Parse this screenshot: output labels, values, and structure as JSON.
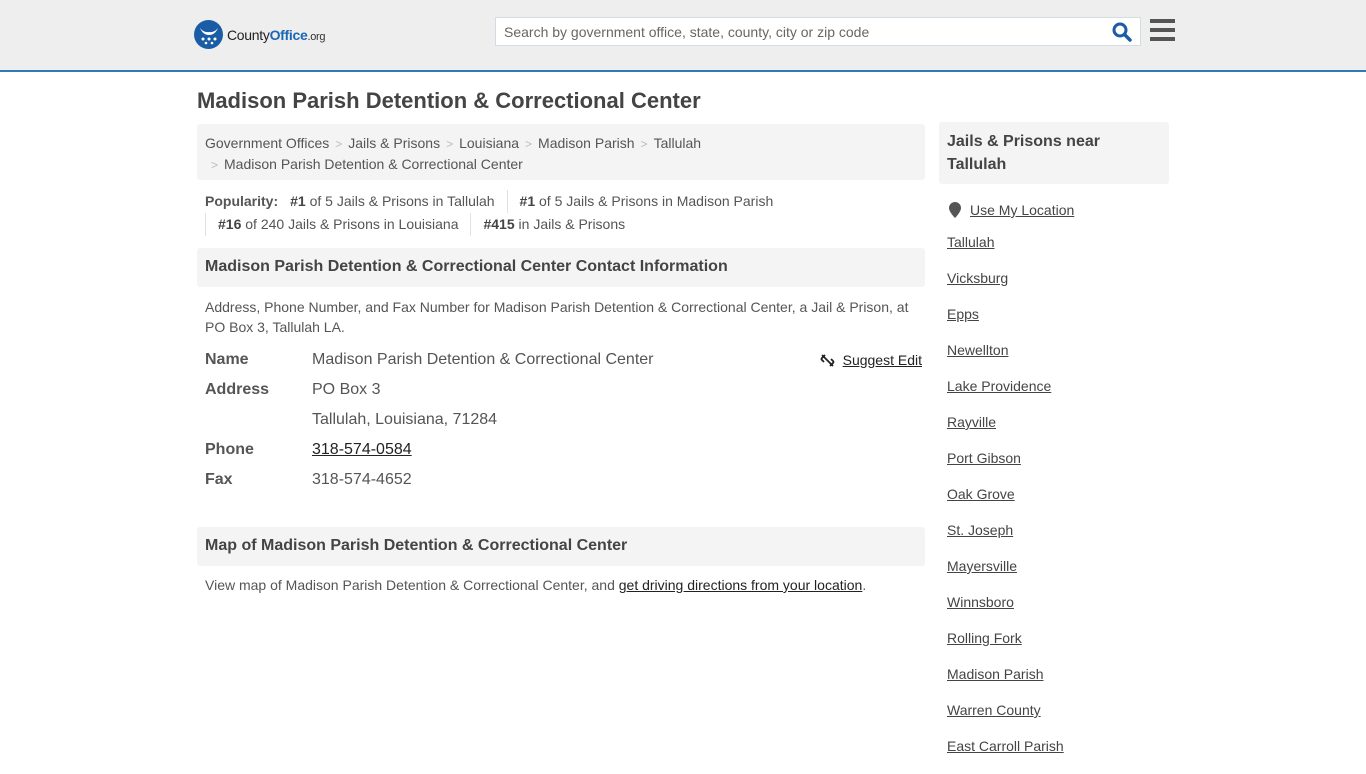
{
  "header": {
    "logo": {
      "county": "County",
      "office": "Office",
      "org": ".org"
    },
    "search_placeholder": "Search by government office, state, county, city or zip code",
    "colors": {
      "brand_blue": "#1a5da6",
      "accent_border": "#2f7bb5"
    }
  },
  "page_title": "Madison Parish Detention & Correctional Center",
  "breadcrumb": [
    {
      "label": "Government Offices"
    },
    {
      "label": "Jails & Prisons"
    },
    {
      "label": "Louisiana"
    },
    {
      "label": "Madison Parish"
    },
    {
      "label": "Tallulah"
    },
    {
      "label": "Madison Parish Detention & Correctional Center"
    }
  ],
  "popularity": {
    "label": "Popularity:",
    "items": [
      {
        "rank": "#1",
        "text": " of 5 Jails & Prisons in Tallulah"
      },
      {
        "rank": "#1",
        "text": " of 5 Jails & Prisons in Madison Parish"
      },
      {
        "rank": "#16",
        "text": " of 240 Jails & Prisons in Louisiana"
      },
      {
        "rank": "#415",
        "text": " in Jails & Prisons"
      }
    ]
  },
  "contact": {
    "heading": "Madison Parish Detention & Correctional Center Contact Information",
    "description": "Address, Phone Number, and Fax Number for Madison Parish Detention & Correctional Center, a Jail & Prison, at PO Box 3, Tallulah LA.",
    "suggest_edit": "Suggest Edit",
    "fields": {
      "name_label": "Name",
      "name": "Madison Parish Detention & Correctional Center",
      "address_label": "Address",
      "address_line1": "PO Box 3",
      "address_line2": "Tallulah, Louisiana, 71284",
      "phone_label": "Phone",
      "phone": "318-574-0584",
      "fax_label": "Fax",
      "fax": "318-574-4652"
    }
  },
  "map": {
    "heading": "Map of Madison Parish Detention & Correctional Center",
    "desc_prefix": "View map of Madison Parish Detention & Correctional Center, and ",
    "directions_link": "get driving directions from your location",
    "desc_suffix": "."
  },
  "sidebar": {
    "heading": "Jails & Prisons near Tallulah",
    "use_location": "Use My Location",
    "links": [
      "Tallulah",
      "Vicksburg",
      "Epps",
      "Newellton",
      "Lake Providence",
      "Rayville",
      "Port Gibson",
      "Oak Grove",
      "St. Joseph",
      "Mayersville",
      "Winnsboro",
      "Rolling Fork",
      "Madison Parish",
      "Warren County",
      "East Carroll Parish"
    ]
  }
}
